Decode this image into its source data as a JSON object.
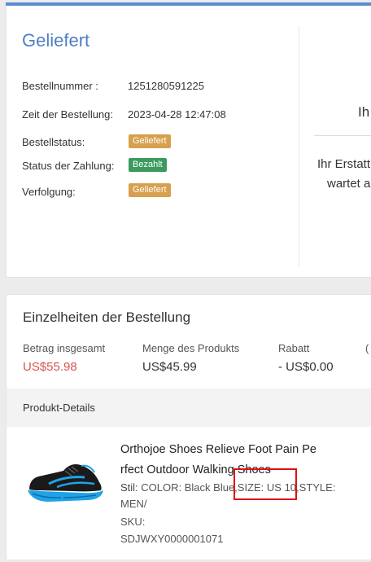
{
  "order": {
    "status_title": "Geliefert",
    "rows": {
      "order_number_label": "Bestellnummer :",
      "order_number_value": "1251280591225",
      "order_time_label": "Zeit der Bestellung:",
      "order_time_value": "2023-04-28 12:47:08",
      "order_status_label": "Bestellstatus:",
      "order_status_badge": "Geliefert",
      "payment_status_label": "Status der Zahlung:",
      "payment_status_badge": "Bezahlt",
      "tracking_label": "Verfolgung:",
      "tracking_badge": "Geliefert"
    },
    "right_panel": {
      "heading": "Ih",
      "line1": "Ihr Erstatt",
      "line2": "wartet a"
    }
  },
  "details": {
    "title": "Einzelheiten der Bestellung",
    "summary": [
      {
        "label": "Betrag insgesamt",
        "value": "US$55.98"
      },
      {
        "label": "Menge des Produkts",
        "value": "US$45.99"
      },
      {
        "label": "Rabatt",
        "value": "- US$0.00"
      },
      {
        "label": "(",
        "value": ""
      }
    ],
    "product_header": "Produkt-Details",
    "product": {
      "image_icon": "shoe-image",
      "name_line1": "Orthojoe Shoes Relieve Foot Pain Pe",
      "name_line2": "rfect Outdoor Walking Shoes",
      "style_label": "Stil:",
      "style_value": "COLOR: Black Blue,SIZE: US 10,STYLE:",
      "style_value_cont": "MEN/",
      "sku_label": "SKU:",
      "sku_value": "SDJWXY0000001071"
    }
  },
  "colors": {
    "accent": "#4e7fc4",
    "badge_orange": "#d7a04e",
    "badge_green": "#3c9a5f",
    "price_red": "#d9534f",
    "highlight_box": "#e01010"
  }
}
